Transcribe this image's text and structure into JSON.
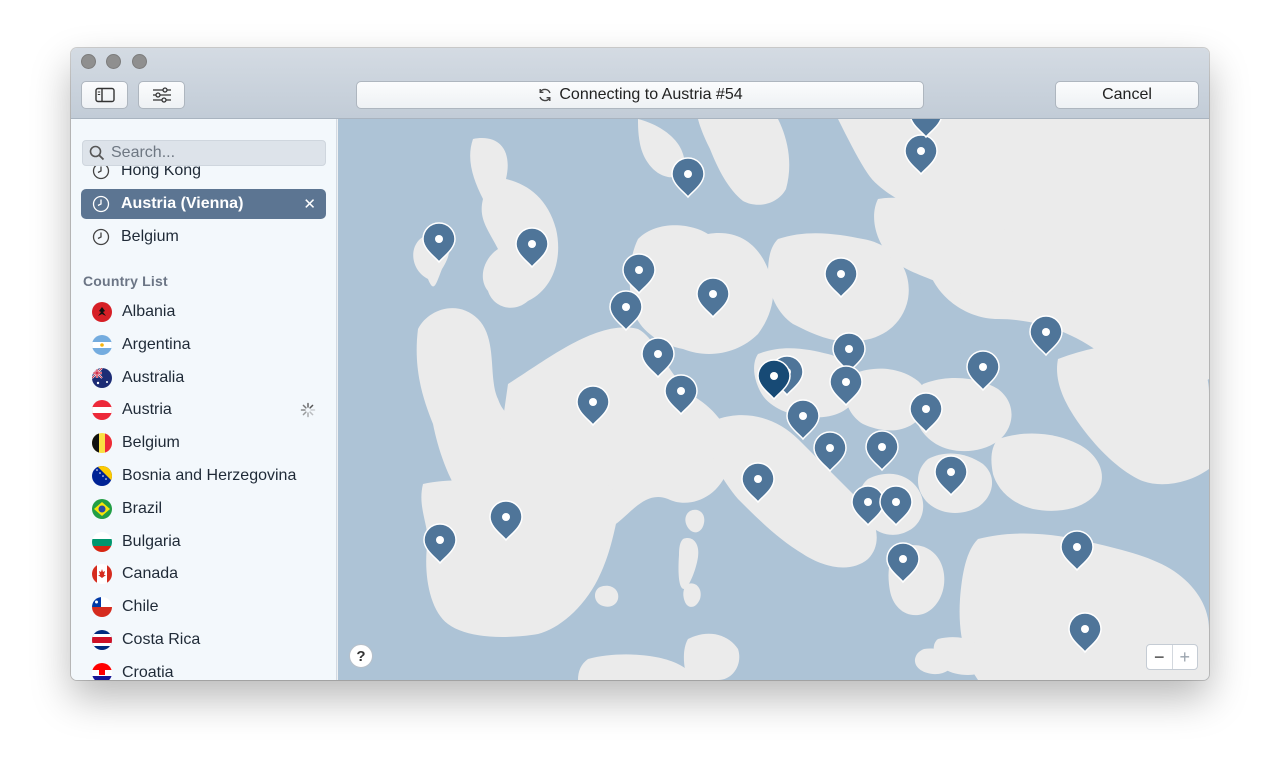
{
  "toolbar": {
    "status_label": "Connecting to Austria #54",
    "cancel_label": "Cancel"
  },
  "sidebar": {
    "search_placeholder": "Search...",
    "recent": [
      {
        "label": "Hong Kong",
        "selected": false
      },
      {
        "label": "Austria (Vienna)",
        "selected": true
      },
      {
        "label": "Belgium",
        "selected": false
      }
    ],
    "section_title": "Country List",
    "countries": [
      {
        "label": "Albania",
        "flag": "albania-flag"
      },
      {
        "label": "Argentina",
        "flag": "argentina-flag"
      },
      {
        "label": "Australia",
        "flag": "australia-flag"
      },
      {
        "label": "Austria",
        "flag": "austria-flag",
        "loading": true
      },
      {
        "label": "Belgium",
        "flag": "belgium-flag"
      },
      {
        "label": "Bosnia and Herzegovina",
        "flag": "bosnia-flag"
      },
      {
        "label": "Brazil",
        "flag": "brazil-flag"
      },
      {
        "label": "Bulgaria",
        "flag": "bulgaria-flag"
      },
      {
        "label": "Canada",
        "flag": "canada-flag"
      },
      {
        "label": "Chile",
        "flag": "chile-flag"
      },
      {
        "label": "Costa Rica",
        "flag": "costa-rica-flag"
      },
      {
        "label": "Croatia",
        "flag": "croatia-flag"
      }
    ]
  },
  "map": {
    "help_label": "?",
    "zoom_out_label": "−",
    "zoom_in_label": "+",
    "colors": {
      "water": "#adc3d6",
      "land": "#ebebeb",
      "pin": "#4f7599",
      "pin_active": "#174a75"
    }
  }
}
